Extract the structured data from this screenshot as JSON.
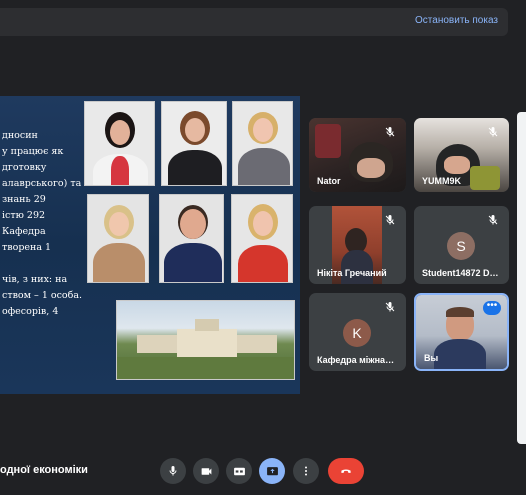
{
  "top_bar": {
    "stop_label": "Остановить показ"
  },
  "slide": {
    "lines_top": [
      "дносин",
      "у працює як",
      "дготовку",
      "алаврського) та",
      "знань 29",
      "істю 292",
      "Кафедра",
      "творена 1"
    ],
    "lines_bottom": [
      "чів, з них: на",
      "ством – 1 особа.",
      "офесорів, 4"
    ]
  },
  "participants": [
    {
      "name": "Nator",
      "muted": true
    },
    {
      "name": "YUMM9K",
      "muted": true
    },
    {
      "name": "Нікіта Гречаний",
      "muted": true
    },
    {
      "name": "Student14872 D…",
      "muted": true,
      "initial": "S",
      "avatar_color": "#8d6e63"
    },
    {
      "name": "Кафедра міжна…",
      "muted": true,
      "initial": "K",
      "avatar_color": "#8d5a4a"
    },
    {
      "name": "Вы",
      "muted": false,
      "self": true
    }
  ],
  "bottom_bar": {
    "meeting_name": "одної економіки"
  },
  "colors": {
    "accent": "#8ab4f8",
    "end_call": "#ea4335",
    "background": "#202124",
    "tile": "#3c4043"
  }
}
